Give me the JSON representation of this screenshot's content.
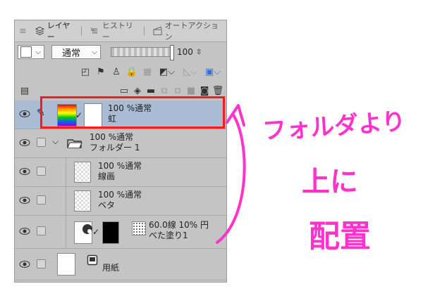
{
  "tabs": [
    {
      "label": "レイヤー",
      "icon": "layers-icon"
    },
    {
      "label": "ヒストリー",
      "icon": "history-icon"
    },
    {
      "label": "オートアクション",
      "icon": "clapper-icon"
    }
  ],
  "blend_mode": "通常",
  "opacity_value": "100",
  "layers": [
    {
      "name_line1": "100 %通常",
      "name_line2": "虹",
      "selected": true
    },
    {
      "name_line1": "100 %通常",
      "name_line2": "フォルダー 1",
      "type": "folder"
    },
    {
      "name_line1": "100 %通常",
      "name_line2": "線画"
    },
    {
      "name_line1": "100 %通常",
      "name_line2": "ベタ"
    },
    {
      "name_line1": "60.0線 10% 円",
      "name_line2": "べた塗り1"
    },
    {
      "name_line1": "用紙",
      "name_line2": ""
    }
  ],
  "annotation": {
    "line1": "フォルダより",
    "line2": "上に",
    "line3": "配置",
    "color": "#ff33cc"
  },
  "highlight_color": "#ff1a1a"
}
